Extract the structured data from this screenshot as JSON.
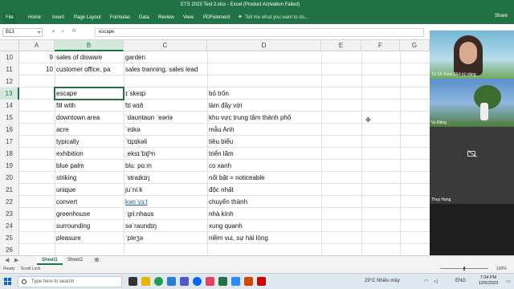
{
  "window": {
    "title": "ETS 2023 Test 2.xlsx - Excel (Product Activation Failed)",
    "share": "Share"
  },
  "tabs": [
    "File",
    "Home",
    "Insert",
    "Page Layout",
    "Formulas",
    "Data",
    "Review",
    "View",
    "PDFelement"
  ],
  "tell_me": "Tell me what you want to do...",
  "namebox": "B13",
  "formula": "escape",
  "columns": [
    "A",
    "B",
    "C",
    "D",
    "E",
    "F",
    "G"
  ],
  "rows": [
    {
      "n": "10",
      "a": "9",
      "b": "sales of disware",
      "c": "garden",
      "d": ""
    },
    {
      "n": "11",
      "a": "10",
      "b": "customer office, pa",
      "c": "sales tranning, sales lead",
      "d": ""
    },
    {
      "n": "12",
      "a": "",
      "b": "",
      "c": "",
      "d": ""
    },
    {
      "n": "13",
      "a": "",
      "b": "escape",
      "c": "ɪˈskeɪp",
      "d": "bỏ trốn"
    },
    {
      "n": "14",
      "a": "",
      "b": "fill with",
      "c": "fɪl wɪð",
      "d": "làm đầy với"
    },
    {
      "n": "15",
      "a": "",
      "b": "downtown area",
      "c": "ˈdaʊntaʊn ˈeəriə",
      "d": "khu vực trung tâm thành phố"
    },
    {
      "n": "16",
      "a": "",
      "b": "acre",
      "c": "ˈeɪkə",
      "d": "mẫu Anh"
    },
    {
      "n": "17",
      "a": "",
      "b": "typically",
      "c": "ˈtɪpɪkəli",
      "d": "tiêu biểu"
    },
    {
      "n": "18",
      "a": "",
      "b": "exhibition",
      "c": "ˌeksɪˈbɪʃᵊn",
      "d": "triển lãm"
    },
    {
      "n": "19",
      "a": "",
      "b": "blue palm",
      "c": "bluː pɑːm",
      "d": "cọ xanh"
    },
    {
      "n": "20",
      "a": "",
      "b": "striking",
      "c": "ˈstraɪkɪŋ",
      "d": "nổi bật = noticeable"
    },
    {
      "n": "21",
      "a": "",
      "b": "unique",
      "c": "juˈniːk",
      "d": "độc nhất"
    },
    {
      "n": "22",
      "a": "",
      "b": "convert",
      "c": "kənˈvɜːt",
      "d": "chuyển thành"
    },
    {
      "n": "23",
      "a": "",
      "b": "greenhouse",
      "c": "ˈɡriːnhaʊs",
      "d": "nhà kính"
    },
    {
      "n": "24",
      "a": "",
      "b": "surrounding",
      "c": "səˈraʊndɪŋ",
      "d": "xung quanh"
    },
    {
      "n": "25",
      "a": "",
      "b": "pleasure",
      "c": "ˈpleʒə",
      "d": "niềm vui, sự hài lòng"
    },
    {
      "n": "26",
      "a": "",
      "b": "",
      "c": "",
      "d": ""
    }
  ],
  "video": {
    "p1": "Tú Võ Toeic 2&4 kỹ năng",
    "p2": "Vy Đặng",
    "p3": "Thuy Hang"
  },
  "sheets": [
    "Sheet1",
    "Sheet2"
  ],
  "status": {
    "ready": "Ready",
    "scroll": "Scroll Lock",
    "zoom": "100%"
  },
  "taskbar": {
    "search": "Type here to search",
    "weather": "29°C Nhiều mây",
    "lang": "ENG",
    "time": "7:34 PM",
    "date": "12/5/2023"
  },
  "colors": {
    "accent": "#217346",
    "link": "#1a5fb4"
  }
}
